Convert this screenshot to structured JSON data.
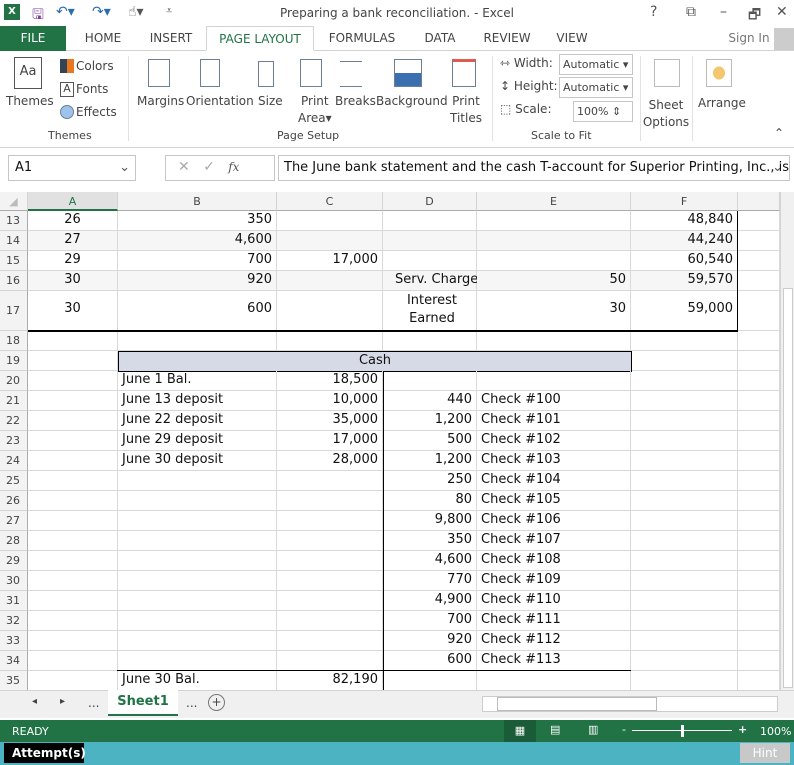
{
  "window": {
    "title": "Preparing a bank reconciliation. - Excel",
    "controls": [
      "?",
      "⧉",
      "–",
      "🗗",
      "✕"
    ]
  },
  "ribbon_tabs": [
    {
      "label": "FILE"
    },
    {
      "label": "HOME"
    },
    {
      "label": "INSERT"
    },
    {
      "label": "PAGE LAYOUT",
      "active": true
    },
    {
      "label": "FORMULAS"
    },
    {
      "label": "DATA"
    },
    {
      "label": "REVIEW"
    },
    {
      "label": "VIEW"
    }
  ],
  "sign_in": "Sign In",
  "ribbon": {
    "themes": {
      "themes": "Themes",
      "colors": "Colors",
      "fonts": "Fonts",
      "effects": "Effects",
      "group": "Themes"
    },
    "page_setup": {
      "margins": "Margins",
      "orientation": "Orientation",
      "size": "Size",
      "print_area_1": "Print",
      "print_area_2": "Area",
      "breaks": "Breaks",
      "background": "Background",
      "print_titles_1": "Print",
      "print_titles_2": "Titles",
      "group": "Page Setup"
    },
    "scale": {
      "width_label": "Width:",
      "width_value": "Automatic",
      "height_label": "Height:",
      "height_value": "Automatic",
      "scale_label": "Scale:",
      "scale_value": "100%",
      "group": "Scale to Fit"
    },
    "sheet_options_1": "Sheet",
    "sheet_options_2": "Options",
    "arrange": "Arrange"
  },
  "formula_bar": {
    "name_box": "A1",
    "fx": "fx",
    "content": "The June bank statement and the cash T-account for Superior Printing, Inc., is"
  },
  "columns": [
    "A",
    "B",
    "C",
    "D",
    "E",
    "F"
  ],
  "rows": [
    {
      "n": "13",
      "cells": {
        "A": "26",
        "B": "350",
        "F": "48,840"
      }
    },
    {
      "n": "14",
      "cells": {
        "A": "27",
        "B": "4,600",
        "F": "44,240"
      }
    },
    {
      "n": "15",
      "cells": {
        "A": "29",
        "B": "700",
        "C": "17,000",
        "F": "60,540"
      }
    },
    {
      "n": "16",
      "cells": {
        "A": "30",
        "B": "920",
        "D": "Serv. Charge",
        "E": "50",
        "F": "59,570"
      }
    },
    {
      "n": "17",
      "cells": {
        "A": "30",
        "B": "600",
        "D": "Interest Earned",
        "E": "30",
        "F": "59,000"
      }
    },
    {
      "n": "18",
      "cells": {}
    },
    {
      "n": "19",
      "cells": {
        "B": "Cash"
      }
    },
    {
      "n": "20",
      "cells": {
        "B": "June 1 Bal.",
        "C": "18,500"
      }
    },
    {
      "n": "21",
      "cells": {
        "B": "June 13 deposit",
        "C": "10,000",
        "D": "440",
        "E": "Check #100"
      }
    },
    {
      "n": "22",
      "cells": {
        "B": "June 22 deposit",
        "C": "35,000",
        "D": "1,200",
        "E": "Check #101"
      }
    },
    {
      "n": "23",
      "cells": {
        "B": "June 29 deposit",
        "C": "17,000",
        "D": "500",
        "E": "Check #102"
      }
    },
    {
      "n": "24",
      "cells": {
        "B": "June 30 deposit",
        "C": "28,000",
        "D": "1,200",
        "E": "Check #103"
      }
    },
    {
      "n": "25",
      "cells": {
        "D": "250",
        "E": "Check #104"
      }
    },
    {
      "n": "26",
      "cells": {
        "D": "80",
        "E": "Check #105"
      }
    },
    {
      "n": "27",
      "cells": {
        "D": "9,800",
        "E": "Check #106"
      }
    },
    {
      "n": "28",
      "cells": {
        "D": "350",
        "E": "Check #107"
      }
    },
    {
      "n": "29",
      "cells": {
        "D": "4,600",
        "E": "Check #108"
      }
    },
    {
      "n": "30",
      "cells": {
        "D": "770",
        "E": "Check #109"
      }
    },
    {
      "n": "31",
      "cells": {
        "D": "4,900",
        "E": "Check #110"
      }
    },
    {
      "n": "32",
      "cells": {
        "D": "700",
        "E": "Check #111"
      }
    },
    {
      "n": "33",
      "cells": {
        "D": "920",
        "E": "Check #112"
      }
    },
    {
      "n": "34",
      "cells": {
        "D": "600",
        "E": "Check #113"
      }
    },
    {
      "n": "35",
      "cells": {
        "B": "June 30 Bal.",
        "C": "82,190"
      }
    }
  ],
  "sheet_tabs": {
    "active": "Sheet1",
    "ellipsis": "..."
  },
  "status": {
    "ready": "READY",
    "zoom": "100%"
  },
  "bottom": {
    "attempts": "Attempt(s)",
    "hint": "Hint"
  },
  "colors": {
    "accent": "#217346",
    "cash_header_fill": "#d6dae6",
    "attempt_bar": "#4bb3c1"
  }
}
